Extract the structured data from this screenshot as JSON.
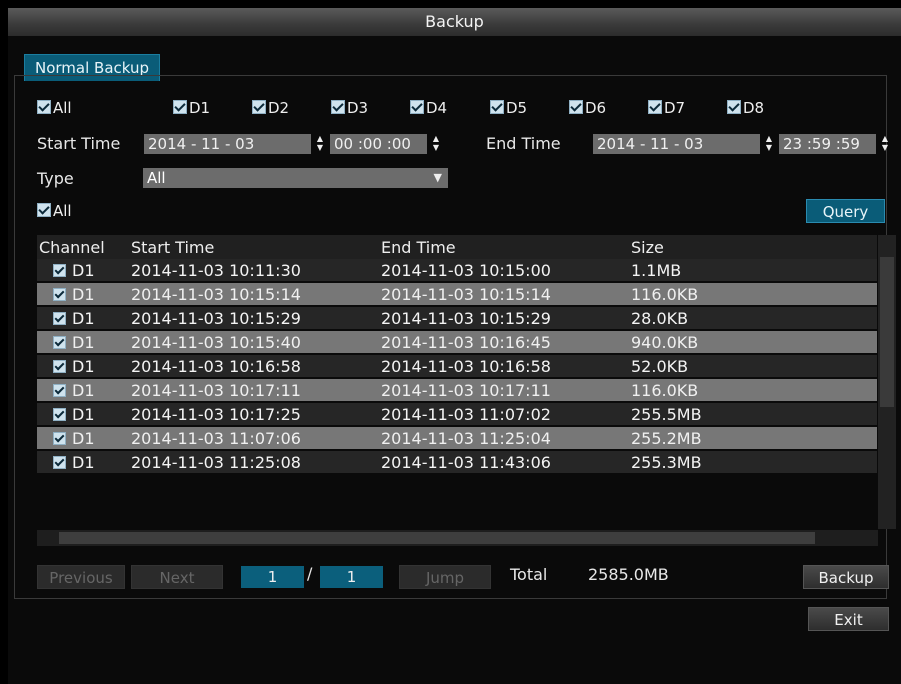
{
  "window": {
    "title": "Backup"
  },
  "tabs": [
    {
      "label": "Normal Backup"
    }
  ],
  "channels": {
    "all_label": "All",
    "items": [
      "D1",
      "D2",
      "D3",
      "D4",
      "D5",
      "D6",
      "D7",
      "D8"
    ]
  },
  "filters": {
    "start_time_label": "Start Time",
    "start_date": "2014 -  11 -  03",
    "start_clock": "00 :00 :00",
    "end_time_label": "End Time",
    "end_date": "2014 -  11 -  03",
    "end_clock": "23 :59 :59",
    "type_label": "Type",
    "type_value": "All",
    "select_all_label": "All",
    "query_label": "Query"
  },
  "table": {
    "headers": [
      "Channel",
      "Start Time",
      "End Time",
      "Size"
    ],
    "rows": [
      {
        "channel": "D1",
        "start": "2014-11-03 10:11:30",
        "end": "2014-11-03 10:15:00",
        "size": "1.1MB"
      },
      {
        "channel": "D1",
        "start": "2014-11-03 10:15:14",
        "end": "2014-11-03 10:15:14",
        "size": "116.0KB"
      },
      {
        "channel": "D1",
        "start": "2014-11-03 10:15:29",
        "end": "2014-11-03 10:15:29",
        "size": "28.0KB"
      },
      {
        "channel": "D1",
        "start": "2014-11-03 10:15:40",
        "end": "2014-11-03 10:16:45",
        "size": "940.0KB"
      },
      {
        "channel": "D1",
        "start": "2014-11-03 10:16:58",
        "end": "2014-11-03 10:16:58",
        "size": "52.0KB"
      },
      {
        "channel": "D1",
        "start": "2014-11-03 10:17:11",
        "end": "2014-11-03 10:17:11",
        "size": "116.0KB"
      },
      {
        "channel": "D1",
        "start": "2014-11-03 10:17:25",
        "end": "2014-11-03 11:07:02",
        "size": "255.5MB"
      },
      {
        "channel": "D1",
        "start": "2014-11-03 11:07:06",
        "end": "2014-11-03 11:25:04",
        "size": "255.2MB"
      },
      {
        "channel": "D1",
        "start": "2014-11-03 11:25:08",
        "end": "2014-11-03 11:43:06",
        "size": "255.3MB"
      }
    ]
  },
  "pagination": {
    "previous_label": "Previous",
    "next_label": "Next",
    "current_page": "1",
    "separator": "/",
    "total_pages": "1",
    "jump_label": "Jump",
    "total_label": "Total",
    "total_size": "2585.0MB",
    "backup_label": "Backup"
  },
  "footer": {
    "exit_label": "Exit"
  },
  "colors": {
    "accent": "#0a5c78",
    "row_alt": "#777777",
    "row_dark": "#262626"
  }
}
